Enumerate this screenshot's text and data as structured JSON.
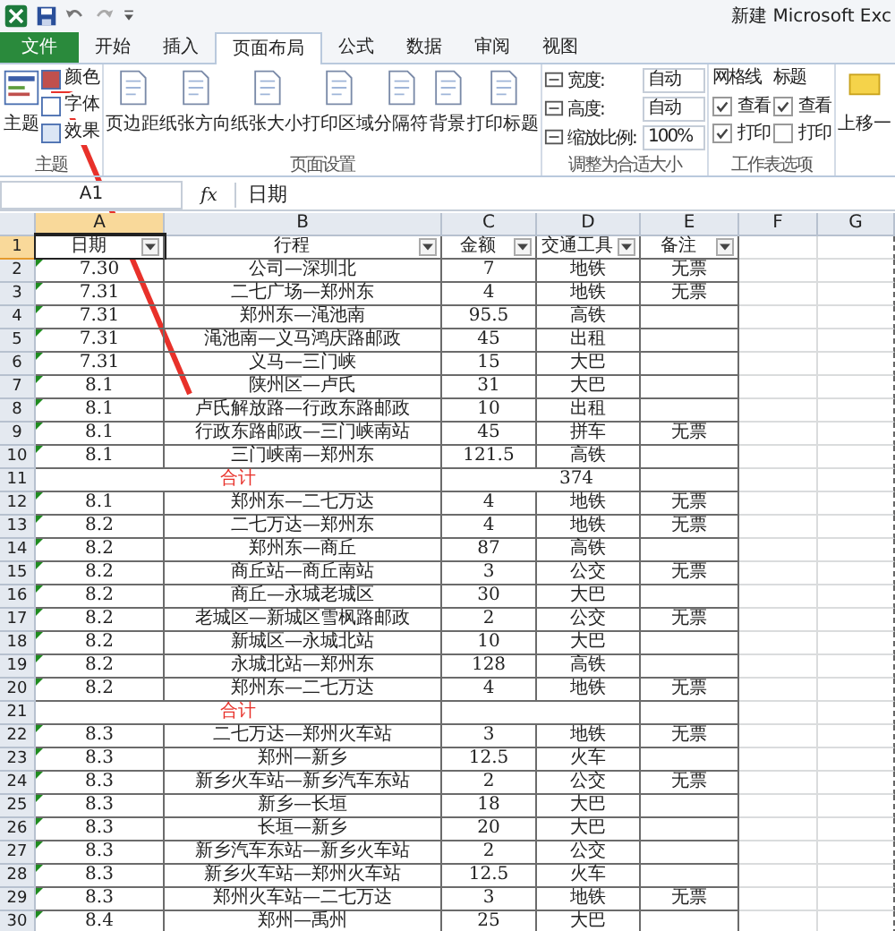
{
  "window": {
    "title": "新建 Microsoft Exc"
  },
  "tabs": [
    {
      "label": "文件",
      "kind": "file",
      "selected": false
    },
    {
      "label": "开始",
      "kind": "tab",
      "selected": false
    },
    {
      "label": "插入",
      "kind": "tab",
      "selected": false
    },
    {
      "label": "页面布局",
      "kind": "tab",
      "selected": true
    },
    {
      "label": "公式",
      "kind": "tab",
      "selected": false
    },
    {
      "label": "数据",
      "kind": "tab",
      "selected": false
    },
    {
      "label": "审阅",
      "kind": "tab",
      "selected": false
    },
    {
      "label": "视图",
      "kind": "tab",
      "selected": false
    }
  ],
  "ribbon": {
    "themes": {
      "label": "主题",
      "main": "主题",
      "items": [
        "颜色",
        "字体",
        "效果"
      ]
    },
    "page_setup": {
      "label": "页面设置",
      "buttons": [
        "页边距",
        "纸张方向",
        "纸张大小",
        "打印区域",
        "分隔符",
        "背景",
        "打印标题"
      ]
    },
    "scale": {
      "label": "调整为合适大小",
      "fields": [
        {
          "label": "宽度:",
          "value": "自动"
        },
        {
          "label": "高度:",
          "value": "自动"
        },
        {
          "label": "缩放比例:",
          "value": "100%"
        }
      ]
    },
    "sheet_options": {
      "label": "工作表选项",
      "columns": [
        {
          "title": "网格线",
          "options": [
            {
              "label": "查看",
              "checked": true
            },
            {
              "label": "打印",
              "checked": true
            }
          ]
        },
        {
          "title": "标题",
          "options": [
            {
              "label": "查看",
              "checked": true
            },
            {
              "label": "打印",
              "checked": false
            }
          ]
        }
      ]
    },
    "arrange": {
      "buttons": [
        "上移一"
      ]
    }
  },
  "formula_bar": {
    "cell": "A1",
    "function_label": "fx",
    "value": "日期"
  },
  "sheet": {
    "columns": [
      {
        "label": "A",
        "selected": true
      },
      {
        "label": "B",
        "selected": false
      },
      {
        "label": "C",
        "selected": false
      },
      {
        "label": "D",
        "selected": false
      },
      {
        "label": "E",
        "selected": false
      },
      {
        "label": "F",
        "selected": false
      },
      {
        "label": "G",
        "selected": false
      }
    ],
    "header": {
      "number": "1",
      "selected": true,
      "cells": [
        "日期",
        "行程",
        "金额",
        "交通工具",
        "备注"
      ]
    },
    "rows": [
      {
        "number": "2",
        "kind": "data",
        "cells": [
          "7.30",
          "公司—深圳北",
          "7",
          "地铁",
          "无票"
        ]
      },
      {
        "number": "3",
        "kind": "data",
        "cells": [
          "7.31",
          "二七广场—郑州东",
          "4",
          "地铁",
          "无票"
        ]
      },
      {
        "number": "4",
        "kind": "data",
        "cells": [
          "7.31",
          "郑州东—渑池南",
          "95.5",
          "高铁"
        ]
      },
      {
        "number": "5",
        "kind": "data",
        "cells": [
          "7.31",
          "渑池南—义马鸿庆路邮政",
          "45",
          "出租"
        ]
      },
      {
        "number": "6",
        "kind": "data",
        "cells": [
          "7.31",
          "义马—三门峡",
          "15",
          "大巴"
        ]
      },
      {
        "number": "7",
        "kind": "data",
        "cells": [
          "8.1",
          "陕州区—卢氏",
          "31",
          "大巴"
        ]
      },
      {
        "number": "8",
        "kind": "data",
        "cells": [
          "8.1",
          "卢氏解放路—行政东路邮政",
          "10",
          "出租"
        ]
      },
      {
        "number": "9",
        "kind": "data",
        "cells": [
          "8.1",
          "行政东路邮政—三门峡南站",
          "45",
          "拼车",
          "无票"
        ]
      },
      {
        "number": "10",
        "kind": "data",
        "cells": [
          "8.1",
          "三门峡南—郑州东",
          "121.5",
          "高铁"
        ]
      },
      {
        "number": "11",
        "kind": "total",
        "label": "合计",
        "value": "374"
      },
      {
        "number": "12",
        "kind": "data",
        "cells": [
          "8.1",
          "郑州东—二七万达",
          "4",
          "地铁",
          "无票"
        ]
      },
      {
        "number": "13",
        "kind": "data",
        "cells": [
          "8.2",
          "二七万达—郑州东",
          "4",
          "地铁",
          "无票"
        ]
      },
      {
        "number": "14",
        "kind": "data",
        "cells": [
          "8.2",
          "郑州东—商丘",
          "87",
          "高铁"
        ]
      },
      {
        "number": "15",
        "kind": "data",
        "cells": [
          "8.2",
          "商丘站—商丘南站",
          "3",
          "公交",
          "无票"
        ]
      },
      {
        "number": "16",
        "kind": "data",
        "cells": [
          "8.2",
          "商丘—永城老城区",
          "30",
          "大巴"
        ]
      },
      {
        "number": "17",
        "kind": "data",
        "cells": [
          "8.2",
          "老城区—新城区雪枫路邮政",
          "2",
          "公交",
          "无票"
        ]
      },
      {
        "number": "18",
        "kind": "data",
        "cells": [
          "8.2",
          "新城区—永城北站",
          "10",
          "大巴"
        ]
      },
      {
        "number": "19",
        "kind": "data",
        "cells": [
          "8.2",
          "永城北站—郑州东",
          "128",
          "高铁"
        ]
      },
      {
        "number": "20",
        "kind": "data",
        "cells": [
          "8.2",
          "郑州东—二七万达",
          "4",
          "地铁",
          "无票"
        ]
      },
      {
        "number": "21",
        "kind": "total",
        "label": "合计"
      },
      {
        "number": "22",
        "kind": "data",
        "cells": [
          "8.3",
          "二七万达—郑州火车站",
          "3",
          "地铁",
          "无票"
        ]
      },
      {
        "number": "23",
        "kind": "data",
        "cells": [
          "8.3",
          "郑州—新乡",
          "12.5",
          "火车"
        ]
      },
      {
        "number": "24",
        "kind": "data",
        "cells": [
          "8.3",
          "新乡火车站—新乡汽车东站",
          "2",
          "公交",
          "无票"
        ]
      },
      {
        "number": "25",
        "kind": "data",
        "cells": [
          "8.3",
          "新乡—长垣",
          "18",
          "大巴"
        ]
      },
      {
        "number": "26",
        "kind": "data",
        "cells": [
          "8.3",
          "长垣—新乡",
          "20",
          "大巴"
        ]
      },
      {
        "number": "27",
        "kind": "data",
        "cells": [
          "8.3",
          "新乡汽车东站—新乡火车站",
          "2",
          "公交"
        ]
      },
      {
        "number": "28",
        "kind": "data",
        "cells": [
          "8.3",
          "新乡火车站—郑州火车站",
          "12.5",
          "火车"
        ]
      },
      {
        "number": "29",
        "kind": "data",
        "cells": [
          "8.3",
          "郑州火车站—二七万达",
          "3",
          "地铁",
          "无票"
        ]
      },
      {
        "number": "30",
        "kind": "data",
        "cells": [
          "8.4",
          "郑州—禹州",
          "25",
          "大巴"
        ]
      }
    ]
  }
}
